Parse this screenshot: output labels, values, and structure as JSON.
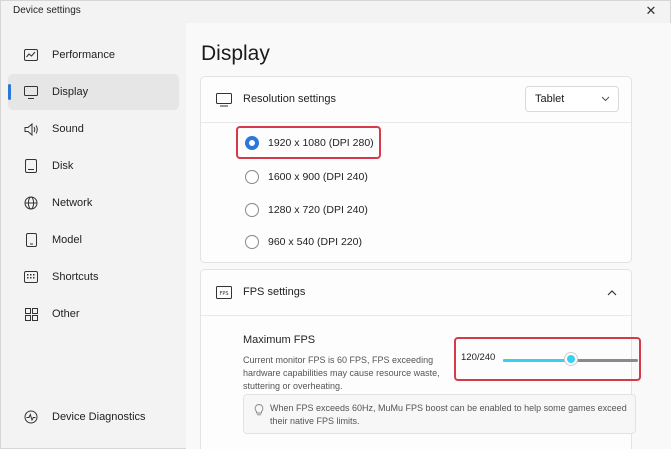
{
  "window": {
    "title": "Device settings",
    "close_glyph": "✕"
  },
  "sidebar": {
    "items": [
      {
        "label": "Performance",
        "icon": "performance-icon",
        "active": false
      },
      {
        "label": "Display",
        "icon": "monitor-icon",
        "active": true
      },
      {
        "label": "Sound",
        "icon": "speaker-icon",
        "active": false
      },
      {
        "label": "Disk",
        "icon": "disk-icon",
        "active": false
      },
      {
        "label": "Network",
        "icon": "globe-icon",
        "active": false
      },
      {
        "label": "Model",
        "icon": "phone-icon",
        "active": false
      },
      {
        "label": "Shortcuts",
        "icon": "keyboard-icon",
        "active": false
      },
      {
        "label": "Other",
        "icon": "grid-icon",
        "active": false
      }
    ],
    "diagnostics": {
      "label": "Device Diagnostics",
      "icon": "diagnostics-icon"
    }
  },
  "main": {
    "title": "Display",
    "resolution": {
      "label": "Resolution settings",
      "select_value": "Tablet",
      "options": [
        {
          "label": "1920 x 1080 (DPI 280)",
          "checked": true
        },
        {
          "label": "1600 x 900 (DPI 240)",
          "checked": false
        },
        {
          "label": "1280 x 720 (DPI 240)",
          "checked": false
        },
        {
          "label": "960 x 540 (DPI 220)",
          "checked": false
        }
      ]
    },
    "fps": {
      "label": "FPS settings",
      "icon_text": "FPS",
      "max_title": "Maximum FPS",
      "description": "Current monitor FPS is 60 FPS, FPS exceeding hardware capabilities may cause resource waste, stuttering or overheating.",
      "value_text": "120/240",
      "value": 120,
      "max": 240,
      "tip": "When FPS exceeds 60Hz, MuMu FPS boost can be enabled to help some games exceed their native FPS limits."
    }
  },
  "colors": {
    "accent": "#2b78d8",
    "slider": "#35d1ee",
    "highlight": "#d63a4a"
  }
}
